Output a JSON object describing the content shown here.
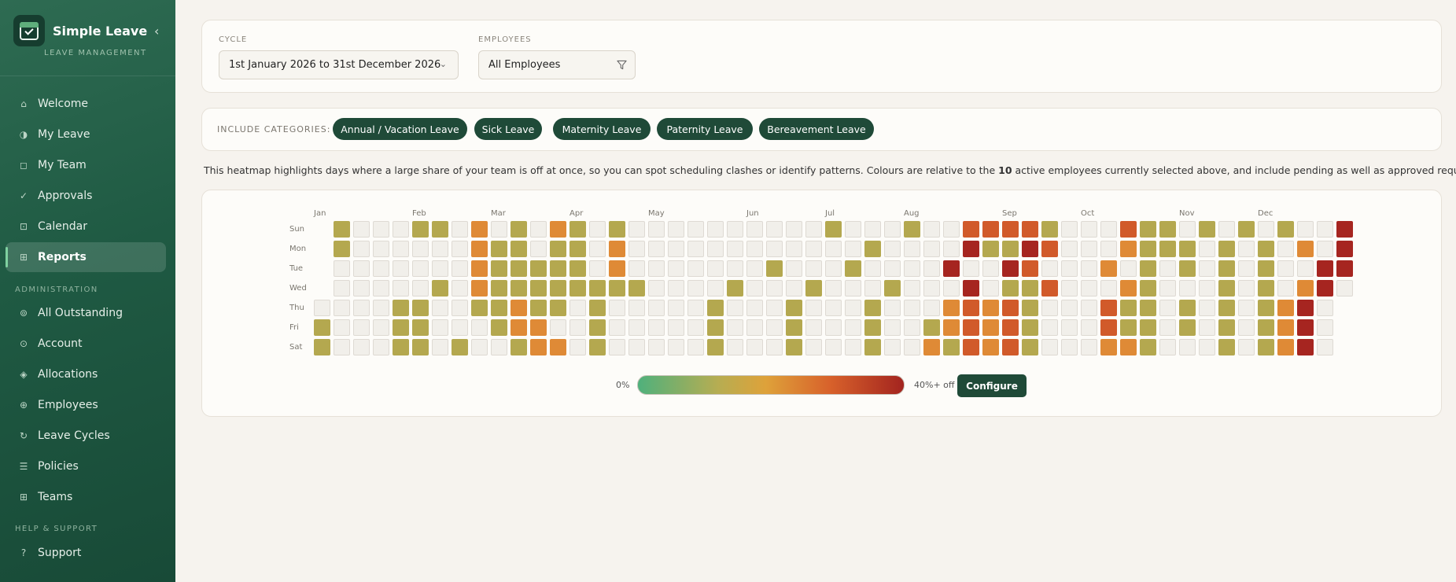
{
  "app": {
    "name": "Simple Leave",
    "subtitle": "LEAVE MANAGEMENT",
    "collapse_glyph": "‹"
  },
  "sidebar": {
    "items": [
      {
        "label": "Welcome",
        "icon": "home-icon",
        "glyph": "⌂",
        "active": false
      },
      {
        "label": "My Leave",
        "icon": "half-circle-icon",
        "glyph": "◑",
        "active": false
      },
      {
        "label": "My Team",
        "icon": "square-icon",
        "glyph": "◻",
        "active": false
      },
      {
        "label": "Approvals",
        "icon": "check-icon",
        "glyph": "✓",
        "active": false
      },
      {
        "label": "Calendar",
        "icon": "calendar-icon",
        "glyph": "⊡",
        "active": false
      },
      {
        "label": "Reports",
        "icon": "grid-icon",
        "glyph": "⊞",
        "active": true
      }
    ],
    "admin_section": "ADMINISTRATION",
    "admin_items": [
      {
        "label": "All Outstanding",
        "icon": "target-icon",
        "glyph": "⊚"
      },
      {
        "label": "Account",
        "icon": "account-icon",
        "glyph": "⊙"
      },
      {
        "label": "Allocations",
        "icon": "diamond-icon",
        "glyph": "◈"
      },
      {
        "label": "Employees",
        "icon": "people-icon",
        "glyph": "⊕"
      },
      {
        "label": "Leave Cycles",
        "icon": "cycle-icon",
        "glyph": "↻"
      },
      {
        "label": "Policies",
        "icon": "list-icon",
        "glyph": "☰"
      },
      {
        "label": "Teams",
        "icon": "teams-icon",
        "glyph": "⊞"
      }
    ],
    "help_section": "HELP & SUPPORT",
    "help_items": [
      {
        "label": "Support",
        "icon": "question-icon",
        "glyph": "?"
      }
    ]
  },
  "filters": {
    "cycle_label": "CYCLE",
    "cycle_value": "1st January 2026 to 31st December 2026",
    "employees_label": "EMPLOYEES",
    "employees_value": "All Employees"
  },
  "categories": {
    "label": "INCLUDE CATEGORIES:",
    "items": [
      "Annual / Vacation Leave",
      "Sick Leave",
      "Maternity Leave",
      "Paternity Leave",
      "Bereavement Leave"
    ]
  },
  "description_parts": {
    "before": "This heatmap highlights days where a large share of your team is off at once, so you can spot scheduling clashes or identify patterns. Colours are relative to the ",
    "count": "10",
    "after": " active employees currently selected above, and include pending as well as approved requests."
  },
  "heatmap": {
    "months": [
      "Jan",
      "Feb",
      "Mar",
      "Apr",
      "May",
      "Jun",
      "Jul",
      "Aug",
      "Sep",
      "Oct",
      "Nov",
      "Dec"
    ],
    "days": [
      "Sun",
      "Mon",
      "Tue",
      "Wed",
      "Thu",
      "Fri",
      "Sat"
    ],
    "levels": {
      "1": "#b4a84f",
      "2": "#df8a36",
      "3": "#d15a2a",
      "4": "#a62520"
    },
    "rows": [
      "-1000110201021010000000000100010033331000311010101004",
      "-1000000211011020000000000001000041143000211101010204",
      "-0000000211111020000000100010000400430002010101010044",
      "-0000010211111111000010001000100040113000210001010240",
      "0000110011211010000010001000100023231000311010101240",
      "1000110001220010000010001000100123231000311010101240",
      "1000110100122010000010001000100213231000221000101240"
    ]
  },
  "legend": {
    "min": "0%",
    "max": "40%+ off",
    "configure": "Configure"
  }
}
